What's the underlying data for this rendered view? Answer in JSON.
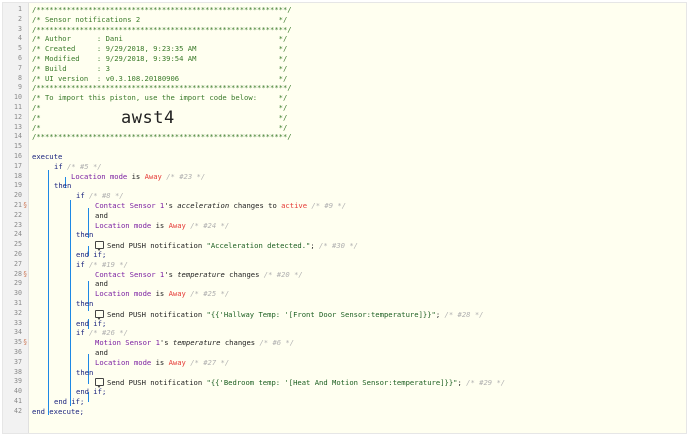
{
  "header_lines": [
    "/**********************************************************/",
    "/* Sensor notifications 2                                */",
    "/**********************************************************/",
    "/* Author      : Dani                                    */",
    "/* Created     : 9/29/2018, 9:23:35 AM                   */",
    "/* Modified    : 9/29/2018, 9:39:54 AM                   */",
    "/* Build       : 3                                       */",
    "/* UI version  : v0.3.108.20180906                       */",
    "/**********************************************************/",
    "/* To import this piston, use the import code below:     */",
    "/*                                                       */",
    "/*                                                       */",
    "/*                                                       */",
    "/**********************************************************/"
  ],
  "import_code": "awst4",
  "line_numbers": [
    "1",
    "2",
    "3",
    "4",
    "5",
    "6",
    "7",
    "8",
    "9",
    "10",
    "11",
    "12",
    "13",
    "14",
    "15",
    "16",
    "17",
    "18",
    "19",
    "20",
    "21",
    "22",
    "23",
    "24",
    "25",
    "26",
    "27",
    "28",
    "29",
    "30",
    "31",
    "32",
    "33",
    "34",
    "35",
    "36",
    "37",
    "38",
    "39",
    "40",
    "41",
    "42"
  ],
  "flag_symbol": "§",
  "kw": {
    "execute": "execute",
    "if": "if",
    "then": "then",
    "and": "and",
    "end_if": "end if;",
    "end_execute": "end execute;",
    "is": "is",
    "changes_to": "changes to",
    "changes": "changes"
  },
  "ids": {
    "i5": "/* #5 */",
    "i23": "/* #23 */",
    "i8": "/* #8 */",
    "i9": "/* #9 */",
    "i24": "/* #24 */",
    "i30": "/* #30 */",
    "i19": "/* #19 */",
    "i20": "/* #20 */",
    "i25": "/* #25 */",
    "i28": "/* #28 */",
    "i26": "/* #26 */",
    "i6": "/* #6 */",
    "i27": "/* #27 */",
    "i29": "/* #29 */"
  },
  "location_mode": "Location mode",
  "away": "Away",
  "contact_sensor": "Contact Sensor 1",
  "motion_sensor": "Motion Sensor 1",
  "possessive": "'s",
  "acceleration": "acceleration",
  "temperature": "temperature",
  "active": "active",
  "send_push": "Send PUSH notification",
  "msg1": "\"Acceleration detected.\"",
  "msg2": "\"{{'Hallway Temp: '[Front Door Sensor:temperature]}}\"",
  "msg3": "\"{{'Bedroom temp: '[Heat And Motion Sensor:temperature]}}\"",
  "semicolon": ";"
}
